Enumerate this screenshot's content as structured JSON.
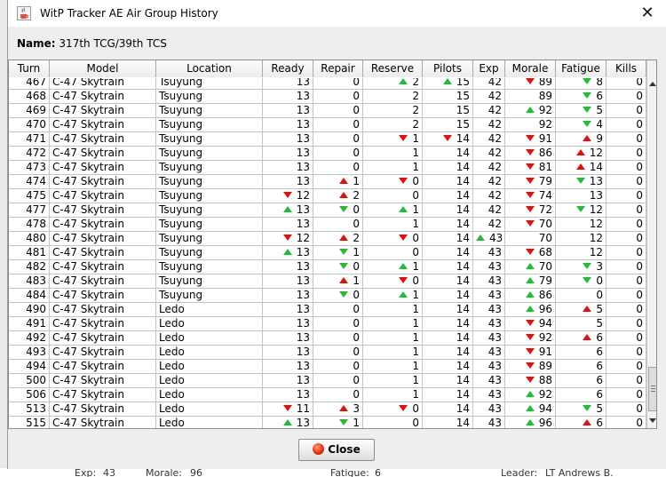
{
  "window": {
    "title": "WitP Tracker AE Air Group History",
    "close_glyph": "✕"
  },
  "group": {
    "name_label": "Name:",
    "name_value": "317th TCG/39th TCS"
  },
  "columns": [
    "Turn",
    "Model",
    "Location",
    "Ready",
    "Repair",
    "Reserve",
    "Pilots",
    "Exp",
    "Morale",
    "Fatigue",
    "Kills"
  ],
  "colors": {
    "up": "#22bb33",
    "down": "#dd1111"
  },
  "rows": [
    {
      "turn": "467",
      "model": "C-47 Skytrain",
      "location": "Tsuyung",
      "ready": "13",
      "repair": "0",
      "reserve": "2",
      "reserve_t": "up",
      "pilots": "15",
      "pilots_t": "up",
      "exp": "42",
      "morale": "89",
      "morale_t": "down",
      "fatigue": "8",
      "fatigue_t": "greendown",
      "kills": "0"
    },
    {
      "turn": "468",
      "model": "C-47 Skytrain",
      "location": "Tsuyung",
      "ready": "13",
      "repair": "0",
      "reserve": "2",
      "pilots": "15",
      "exp": "42",
      "morale": "89",
      "fatigue": "6",
      "fatigue_t": "greendown",
      "kills": "0"
    },
    {
      "turn": "469",
      "model": "C-47 Skytrain",
      "location": "Tsuyung",
      "ready": "13",
      "repair": "0",
      "reserve": "2",
      "pilots": "15",
      "exp": "42",
      "morale": "92",
      "morale_t": "up",
      "fatigue": "5",
      "fatigue_t": "greendown",
      "kills": "0"
    },
    {
      "turn": "470",
      "model": "C-47 Skytrain",
      "location": "Tsuyung",
      "ready": "13",
      "repair": "0",
      "reserve": "2",
      "pilots": "15",
      "exp": "42",
      "morale": "92",
      "fatigue": "4",
      "fatigue_t": "greendown",
      "kills": "0"
    },
    {
      "turn": "471",
      "model": "C-47 Skytrain",
      "location": "Tsuyung",
      "ready": "13",
      "repair": "0",
      "reserve": "1",
      "reserve_t": "down",
      "pilots": "14",
      "pilots_t": "down",
      "exp": "42",
      "morale": "91",
      "morale_t": "down",
      "fatigue": "9",
      "fatigue_t": "redup",
      "kills": "0"
    },
    {
      "turn": "472",
      "model": "C-47 Skytrain",
      "location": "Tsuyung",
      "ready": "13",
      "repair": "0",
      "reserve": "1",
      "pilots": "14",
      "exp": "42",
      "morale": "86",
      "morale_t": "down",
      "fatigue": "12",
      "fatigue_t": "redup",
      "kills": "0"
    },
    {
      "turn": "473",
      "model": "C-47 Skytrain",
      "location": "Tsuyung",
      "ready": "13",
      "repair": "0",
      "reserve": "1",
      "pilots": "14",
      "exp": "42",
      "morale": "81",
      "morale_t": "down",
      "fatigue": "14",
      "fatigue_t": "redup",
      "kills": "0"
    },
    {
      "turn": "474",
      "model": "C-47 Skytrain",
      "location": "Tsuyung",
      "ready": "13",
      "repair": "1",
      "repair_t": "redup",
      "reserve": "0",
      "reserve_t": "down",
      "pilots": "14",
      "exp": "42",
      "morale": "79",
      "morale_t": "down",
      "fatigue": "13",
      "fatigue_t": "greendown",
      "kills": "0"
    },
    {
      "turn": "475",
      "model": "C-47 Skytrain",
      "location": "Tsuyung",
      "ready": "12",
      "ready_t": "down",
      "repair": "2",
      "repair_t": "redup",
      "reserve": "0",
      "pilots": "14",
      "exp": "42",
      "morale": "74",
      "morale_t": "down",
      "fatigue": "13",
      "kills": "0"
    },
    {
      "turn": "477",
      "model": "C-47 Skytrain",
      "location": "Tsuyung",
      "ready": "13",
      "ready_t": "up",
      "repair": "0",
      "repair_t": "greendown",
      "reserve": "1",
      "reserve_t": "up",
      "pilots": "14",
      "exp": "42",
      "morale": "72",
      "morale_t": "down",
      "fatigue": "12",
      "fatigue_t": "greendown",
      "kills": "0"
    },
    {
      "turn": "478",
      "model": "C-47 Skytrain",
      "location": "Tsuyung",
      "ready": "13",
      "repair": "0",
      "reserve": "1",
      "pilots": "14",
      "exp": "42",
      "morale": "70",
      "morale_t": "down",
      "fatigue": "12",
      "kills": "0"
    },
    {
      "turn": "480",
      "model": "C-47 Skytrain",
      "location": "Tsuyung",
      "ready": "12",
      "ready_t": "down",
      "repair": "2",
      "repair_t": "redup",
      "reserve": "0",
      "reserve_t": "down",
      "pilots": "14",
      "exp": "43",
      "exp_t": "up",
      "morale": "70",
      "fatigue": "12",
      "kills": "0"
    },
    {
      "turn": "481",
      "model": "C-47 Skytrain",
      "location": "Tsuyung",
      "ready": "13",
      "ready_t": "up",
      "repair": "1",
      "repair_t": "greendown",
      "reserve": "0",
      "pilots": "14",
      "exp": "43",
      "morale": "68",
      "morale_t": "down",
      "fatigue": "12",
      "kills": "0"
    },
    {
      "turn": "482",
      "model": "C-47 Skytrain",
      "location": "Tsuyung",
      "ready": "13",
      "repair": "0",
      "repair_t": "greendown",
      "reserve": "1",
      "reserve_t": "up",
      "pilots": "14",
      "exp": "43",
      "morale": "70",
      "morale_t": "up",
      "fatigue": "3",
      "fatigue_t": "greendown",
      "kills": "0"
    },
    {
      "turn": "483",
      "model": "C-47 Skytrain",
      "location": "Tsuyung",
      "ready": "13",
      "repair": "1",
      "repair_t": "redup",
      "reserve": "0",
      "reserve_t": "down",
      "pilots": "14",
      "exp": "43",
      "morale": "79",
      "morale_t": "up",
      "fatigue": "0",
      "fatigue_t": "greendown",
      "kills": "0"
    },
    {
      "turn": "484",
      "model": "C-47 Skytrain",
      "location": "Tsuyung",
      "ready": "13",
      "repair": "0",
      "repair_t": "greendown",
      "reserve": "1",
      "reserve_t": "up",
      "pilots": "14",
      "exp": "43",
      "morale": "86",
      "morale_t": "up",
      "fatigue": "0",
      "kills": "0"
    },
    {
      "turn": "490",
      "model": "C-47 Skytrain",
      "location": "Ledo",
      "ready": "13",
      "repair": "0",
      "reserve": "1",
      "pilots": "14",
      "exp": "43",
      "morale": "96",
      "morale_t": "up",
      "fatigue": "5",
      "fatigue_t": "redup",
      "kills": "0"
    },
    {
      "turn": "491",
      "model": "C-47 Skytrain",
      "location": "Ledo",
      "ready": "13",
      "repair": "0",
      "reserve": "1",
      "pilots": "14",
      "exp": "43",
      "morale": "94",
      "morale_t": "down",
      "fatigue": "5",
      "kills": "0"
    },
    {
      "turn": "492",
      "model": "C-47 Skytrain",
      "location": "Ledo",
      "ready": "13",
      "repair": "0",
      "reserve": "1",
      "pilots": "14",
      "exp": "43",
      "morale": "92",
      "morale_t": "down",
      "fatigue": "6",
      "fatigue_t": "redup",
      "kills": "0"
    },
    {
      "turn": "493",
      "model": "C-47 Skytrain",
      "location": "Ledo",
      "ready": "13",
      "repair": "0",
      "reserve": "1",
      "pilots": "14",
      "exp": "43",
      "morale": "91",
      "morale_t": "down",
      "fatigue": "6",
      "kills": "0"
    },
    {
      "turn": "494",
      "model": "C-47 Skytrain",
      "location": "Ledo",
      "ready": "13",
      "repair": "0",
      "reserve": "1",
      "pilots": "14",
      "exp": "43",
      "morale": "89",
      "morale_t": "down",
      "fatigue": "6",
      "kills": "0"
    },
    {
      "turn": "500",
      "model": "C-47 Skytrain",
      "location": "Ledo",
      "ready": "13",
      "repair": "0",
      "reserve": "1",
      "pilots": "14",
      "exp": "43",
      "morale": "88",
      "morale_t": "down",
      "fatigue": "6",
      "kills": "0"
    },
    {
      "turn": "506",
      "model": "C-47 Skytrain",
      "location": "Ledo",
      "ready": "13",
      "repair": "0",
      "reserve": "1",
      "pilots": "14",
      "exp": "43",
      "morale": "92",
      "morale_t": "up",
      "fatigue": "6",
      "kills": "0"
    },
    {
      "turn": "513",
      "model": "C-47 Skytrain",
      "location": "Ledo",
      "ready": "11",
      "ready_t": "down",
      "repair": "3",
      "repair_t": "redup",
      "reserve": "0",
      "reserve_t": "down",
      "pilots": "14",
      "exp": "43",
      "morale": "94",
      "morale_t": "up",
      "fatigue": "5",
      "fatigue_t": "greendown",
      "kills": "0"
    },
    {
      "turn": "515",
      "model": "C-47 Skytrain",
      "location": "Ledo",
      "ready": "13",
      "ready_t": "up",
      "repair": "1",
      "repair_t": "greendown",
      "reserve": "0",
      "pilots": "14",
      "exp": "43",
      "morale": "96",
      "morale_t": "up",
      "fatigue": "6",
      "fatigue_t": "redup",
      "kills": "0"
    }
  ],
  "buttons": {
    "close_label": "Close"
  },
  "underlying": {
    "exp_label": "Exp:",
    "exp_value": "43",
    "morale_label": "Morale:",
    "morale_value": "96",
    "fatigue_label": "Fatigue:",
    "fatigue_value": "6",
    "leader_label": "Leader:",
    "leader_value": "LT Andrews B."
  }
}
